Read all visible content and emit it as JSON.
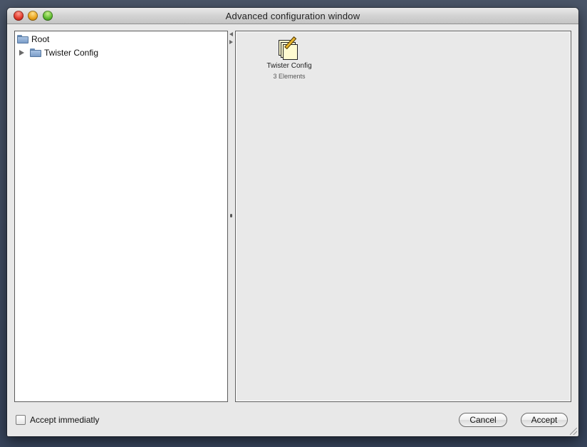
{
  "window": {
    "title": "Advanced configuration window"
  },
  "tree": {
    "items": [
      {
        "label": "Root",
        "icon": "folder-icon",
        "expanded": true
      },
      {
        "label": "Twister Config",
        "icon": "folder-icon",
        "expanded": false
      }
    ]
  },
  "content": {
    "items": [
      {
        "label": "Twister Config",
        "sublabel": "3 Elements",
        "icon": "notes-pencil-icon"
      }
    ]
  },
  "footer": {
    "checkbox_label": "Accept immediatly",
    "checkbox_checked": false,
    "cancel_label": "Cancel",
    "accept_label": "Accept"
  }
}
